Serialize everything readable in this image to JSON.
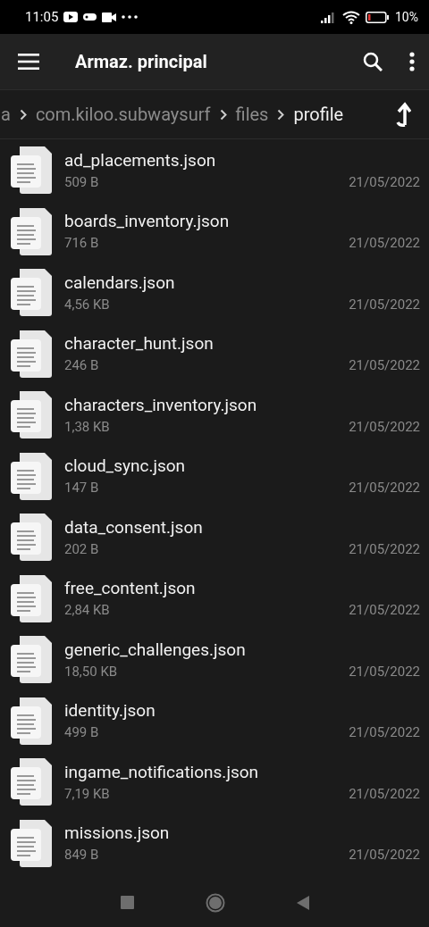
{
  "status_bar": {
    "time": "11:05",
    "battery": "10%"
  },
  "app_bar": {
    "title": "Armaz. principal"
  },
  "breadcrumb": [
    {
      "label": "a",
      "current": false
    },
    {
      "label": "com.kiloo.subwaysurf",
      "current": false
    },
    {
      "label": "files",
      "current": false
    },
    {
      "label": "profile",
      "current": true
    }
  ],
  "files": [
    {
      "name": "ad_placements.json",
      "size": "509 B",
      "date": "21/05/2022"
    },
    {
      "name": "boards_inventory.json",
      "size": "716 B",
      "date": "21/05/2022"
    },
    {
      "name": "calendars.json",
      "size": "4,56 KB",
      "date": "21/05/2022"
    },
    {
      "name": "character_hunt.json",
      "size": "246 B",
      "date": "21/05/2022"
    },
    {
      "name": "characters_inventory.json",
      "size": "1,38 KB",
      "date": "21/05/2022"
    },
    {
      "name": "cloud_sync.json",
      "size": "147 B",
      "date": "21/05/2022"
    },
    {
      "name": "data_consent.json",
      "size": "202 B",
      "date": "21/05/2022"
    },
    {
      "name": "free_content.json",
      "size": "2,84 KB",
      "date": "21/05/2022"
    },
    {
      "name": "generic_challenges.json",
      "size": "18,50 KB",
      "date": "21/05/2022"
    },
    {
      "name": "identity.json",
      "size": "499 B",
      "date": "21/05/2022"
    },
    {
      "name": "ingame_notifications.json",
      "size": "7,19 KB",
      "date": "21/05/2022"
    },
    {
      "name": "missions.json",
      "size": "849 B",
      "date": "21/05/2022"
    }
  ]
}
